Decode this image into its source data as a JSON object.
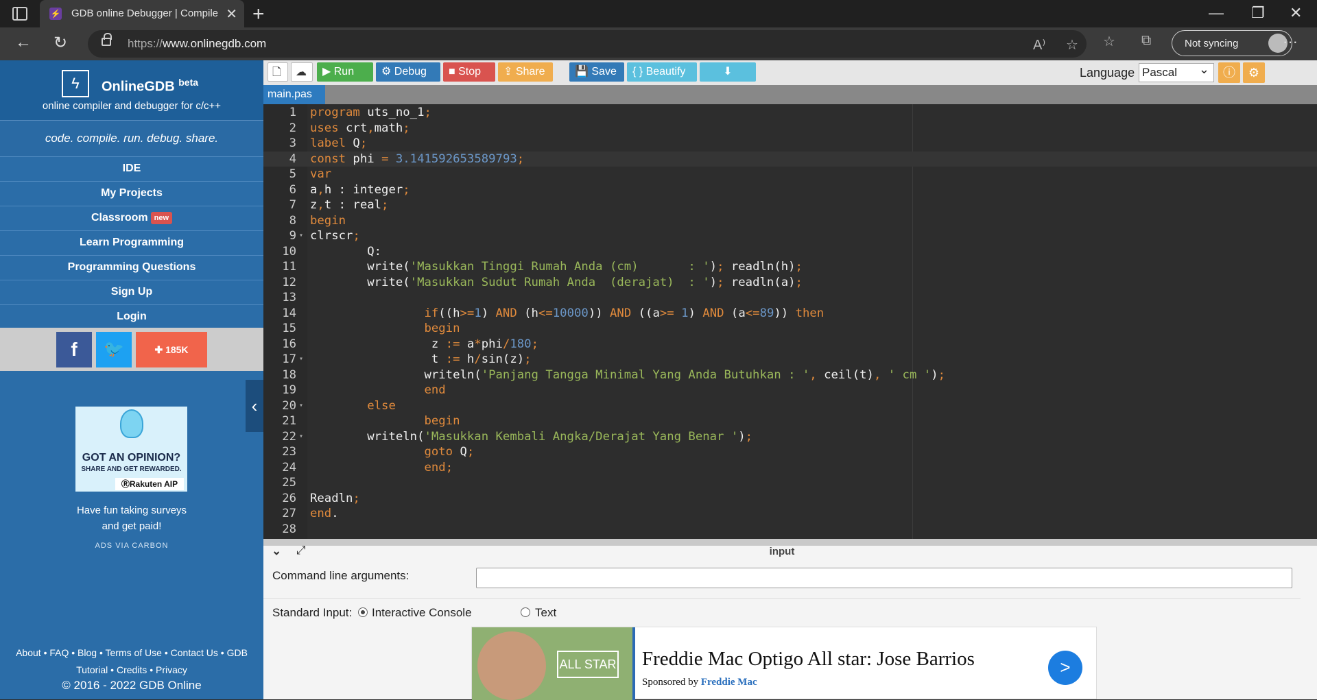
{
  "browser": {
    "tab_title": "GDB online Debugger | Compiler",
    "url_prefix": "https://",
    "url_host": "www.onlinegdb.com",
    "profile_label": "Not syncing"
  },
  "sidebar": {
    "brand": "OnlineGDB",
    "brand_sup": "beta",
    "brand_sub": "online compiler and debugger for c/c++",
    "tagline": "code. compile. run. debug. share.",
    "menu": [
      {
        "label": "IDE"
      },
      {
        "label": "My Projects"
      },
      {
        "label": "Classroom",
        "badge": "new"
      },
      {
        "label": "Learn Programming"
      },
      {
        "label": "Programming Questions"
      },
      {
        "label": "Sign Up"
      },
      {
        "label": "Login"
      }
    ],
    "social": {
      "share_count": "185K"
    },
    "ad": {
      "headline": "GOT AN OPINION?",
      "sub": "SHARE AND GET REWARDED.",
      "brand": "ⓇRakuten AIP",
      "text_line1": "Have fun taking surveys",
      "text_line2": "and get paid!",
      "via": "ADS VIA CARBON"
    },
    "footer_line1": "About • FAQ • Blog • Terms of Use • Contact Us • GDB",
    "footer_line2": "Tutorial • Credits • Privacy",
    "copyright": "© 2016 - 2022 GDB Online"
  },
  "toolbar": {
    "run": "Run",
    "debug": "Debug",
    "stop": "Stop",
    "share": "Share",
    "save": "Save",
    "beautify": "{ } Beautify",
    "language_label": "Language",
    "language_value": "Pascal"
  },
  "file_tab": "main.pas",
  "editor": {
    "line_numbers": [
      "1",
      "2",
      "3",
      "4",
      "5",
      "6",
      "7",
      "8",
      "9",
      "10",
      "11",
      "12",
      "13",
      "14",
      "15",
      "16",
      "17",
      "18",
      "19",
      "20",
      "21",
      "22",
      "23",
      "24",
      "25",
      "26",
      "27",
      "28"
    ]
  },
  "bottom": {
    "title": "input",
    "cmd_label": "Command line arguments:",
    "stdin_label": "Standard Input:",
    "opt_interactive": "Interactive Console",
    "opt_text": "Text"
  },
  "ad_banner": {
    "badge": "ALL STAR",
    "headline": "Freddie Mac Optigo All star: Jose Barrios",
    "sponsor_prefix": "Sponsored by ",
    "sponsor": "Freddie Mac"
  }
}
